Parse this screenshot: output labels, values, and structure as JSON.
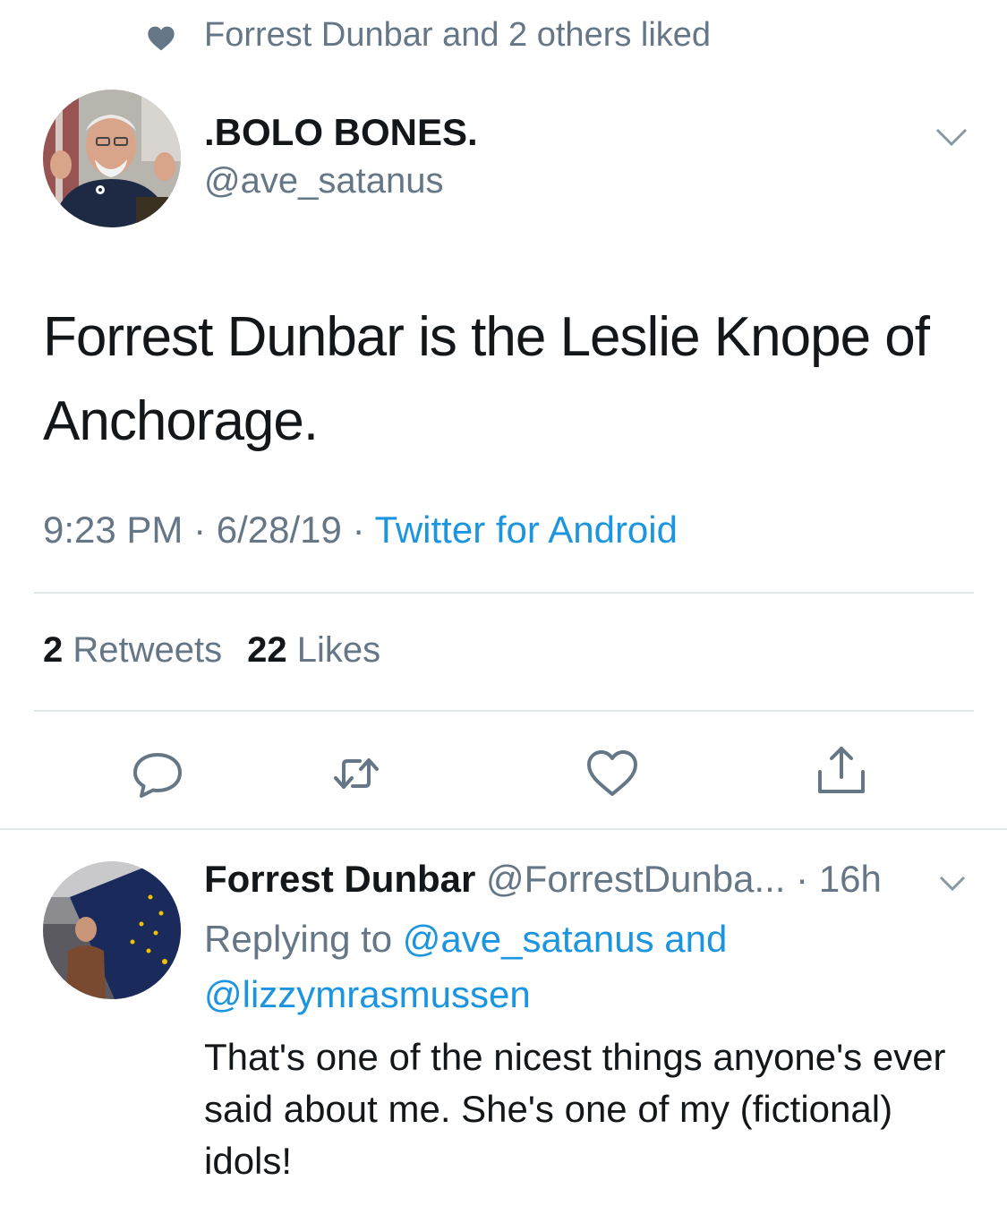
{
  "social_context": {
    "icon": "heart-icon",
    "text": "Forrest Dunbar and 2 others liked"
  },
  "tweet": {
    "display_name": ".BOLO BONES.",
    "handle": "@ave_satanus",
    "text": "Forrest Dunbar is the Leslie Knope of Anchorage.",
    "time": "9:23 PM",
    "separator": "·",
    "date": "6/28/19",
    "source": "Twitter for Android",
    "retweets_count": "2",
    "retweets_label": "Retweets",
    "likes_count": "22",
    "likes_label": "Likes"
  },
  "actions": {
    "reply_icon": "reply-icon",
    "retweet_icon": "retweet-icon",
    "like_icon": "heart-outline-icon",
    "share_icon": "share-icon"
  },
  "reply": {
    "display_name": "Forrest Dunbar",
    "handle": "@ForrestDunba...",
    "separator": "·",
    "age": "16h",
    "replying_to_label": "Replying to",
    "mention_1": "@ave_satanus",
    "and_label": "and",
    "mention_2": "@lizzymrasmussen",
    "text": "That's one of the nicest things anyone's ever said about me. She's one of my (fictional) idols!"
  },
  "colors": {
    "link": "#1b95e0",
    "secondary_text": "#657786",
    "primary_text": "#14171a",
    "divider": "#e1e8ed"
  }
}
